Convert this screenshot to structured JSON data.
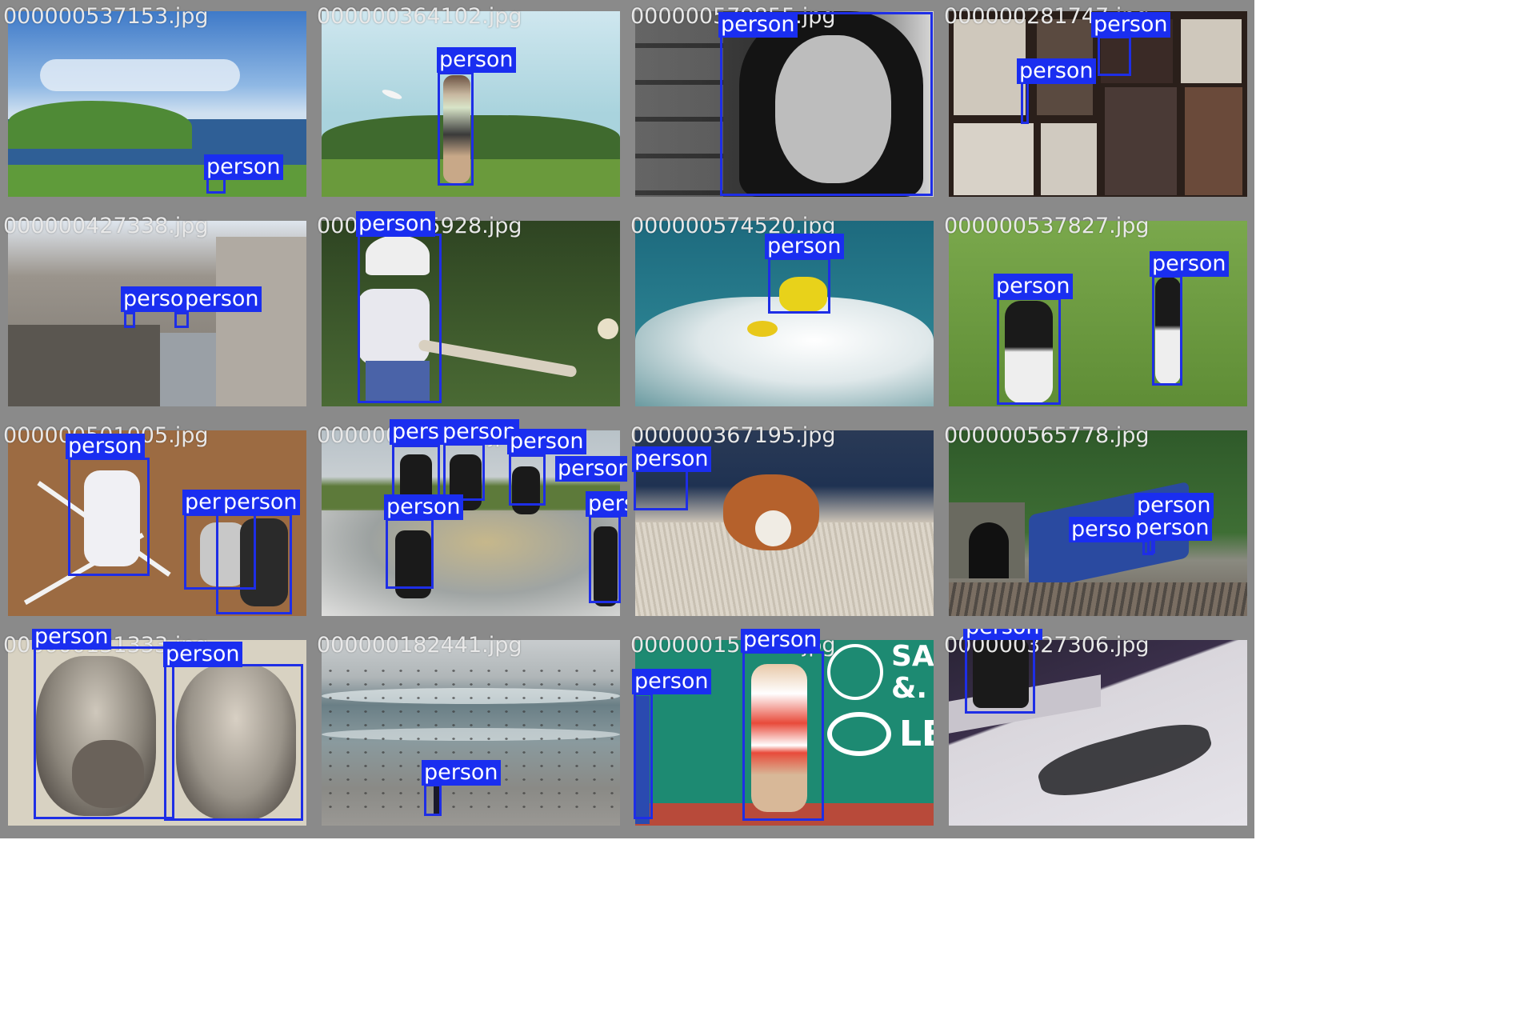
{
  "tiles": [
    {
      "filename": "000000537153.jpg",
      "scene": "coastal cliffs with blue sea and bench",
      "labels": [
        "person"
      ],
      "colors": {
        "sky": "#4f86c8",
        "sea": "#2f5f96",
        "grass": "#5f9b3a"
      }
    },
    {
      "filename": "000000364102.jpg",
      "scene": "woman in field with flying frisbee",
      "labels": [
        "person"
      ],
      "colors": {
        "sky": "#bfe0e8",
        "trees": "#3f6a2e",
        "grass": "#6a9a3c"
      }
    },
    {
      "filename": "000000579855.jpg",
      "scene": "black and white portrait of woman on phone",
      "labels": [
        "person"
      ],
      "colors": {
        "bg": "#3a3a3a",
        "face": "#bdbdbd"
      }
    },
    {
      "filename": "000000281747.jpg",
      "scene": "baseball jersey museum displays",
      "labels": [
        "person",
        "person"
      ],
      "colors": {
        "bg": "#2a1f1a",
        "frame": "#d8d2c8"
      }
    },
    {
      "filename": "000000427338.jpg",
      "scene": "ancient stone ruins",
      "labels": [
        "person",
        "person"
      ],
      "colors": {
        "stone": "#8a8580",
        "sky": "#dfe6ee"
      }
    },
    {
      "filename": "000000535928.jpg",
      "scene": "boy with baseball bat",
      "labels": [
        "person"
      ],
      "colors": {
        "grass": "#3e5a2c",
        "shirt": "#e8e8ee",
        "jeans": "#4a63a8"
      }
    },
    {
      "filename": "000000574520.jpg",
      "scene": "surfer in splashing wave",
      "labels": [
        "person"
      ],
      "colors": {
        "sea": "#1d6a7e",
        "foam": "#e6eef0",
        "surfer": "#e8d21a"
      }
    },
    {
      "filename": "000000537827.jpg",
      "scene": "two baseball players on field",
      "labels": [
        "person",
        "person"
      ],
      "colors": {
        "grass": "#6c9b42",
        "uniform": "#1a1a1a"
      }
    },
    {
      "filename": "000000501005.jpg",
      "scene": "baseball batter, catcher and umpire",
      "labels": [
        "person",
        "person",
        "person"
      ],
      "colors": {
        "dirt": "#9c6b42",
        "lines": "#f2f2f2"
      }
    },
    {
      "filename": "000000194521.jpg",
      "scene": "skaters at graffiti skate bowl",
      "labels": [
        "person",
        "person",
        "person",
        "person",
        "person",
        "person"
      ],
      "colors": {
        "sky": "#b8c2c8",
        "grass": "#5d7a3a",
        "bowl": "#a8a69a"
      }
    },
    {
      "filename": "000000367195.jpg",
      "scene": "corgi lying on shaggy rug",
      "labels": [
        "person"
      ],
      "colors": {
        "rug": "#d9d2c6",
        "dog": "#b5612c",
        "sofa": "#1f3252"
      }
    },
    {
      "filename": "000000565778.jpg",
      "scene": "blue train near tunnel",
      "labels": [
        "person",
        "person",
        "person"
      ],
      "colors": {
        "forest": "#2f5a2a",
        "train": "#2a4aa0",
        "tunnel": "#6a6a60"
      }
    },
    {
      "filename": "000000131333.jpg",
      "scene": "vintage photo of two children",
      "labels": [
        "person",
        "person"
      ],
      "colors": {
        "paper": "#d8d2c2",
        "tone": "#4a4440"
      }
    },
    {
      "filename": "000000182441.jpg",
      "scene": "seagulls on beach with waves",
      "labels": [
        "person"
      ],
      "colors": {
        "sky": "#c8ccce",
        "sea": "#6a7f86",
        "sand": "#8a8a86"
      }
    },
    {
      "filename": "000000152120.jpg",
      "scene": "tennis player hitting forehand",
      "labels": [
        "person",
        "person"
      ],
      "colors": {
        "wall": "#1d8a72",
        "court": "#b84a3a"
      }
    },
    {
      "filename": "000000327306.jpg",
      "scene": "skateboarder grinding ledge with shadow",
      "labels": [
        "person"
      ],
      "colors": {
        "ground": "#d9d6dc",
        "dark": "#3a2f4a"
      }
    }
  ],
  "ad_text": {
    "sa": "SA",
    "amp": "&.",
    "le": "LE"
  },
  "label_color": "#1a2ef0",
  "box_color": "#1e2ee6",
  "filename_color": "#e8e8e8"
}
